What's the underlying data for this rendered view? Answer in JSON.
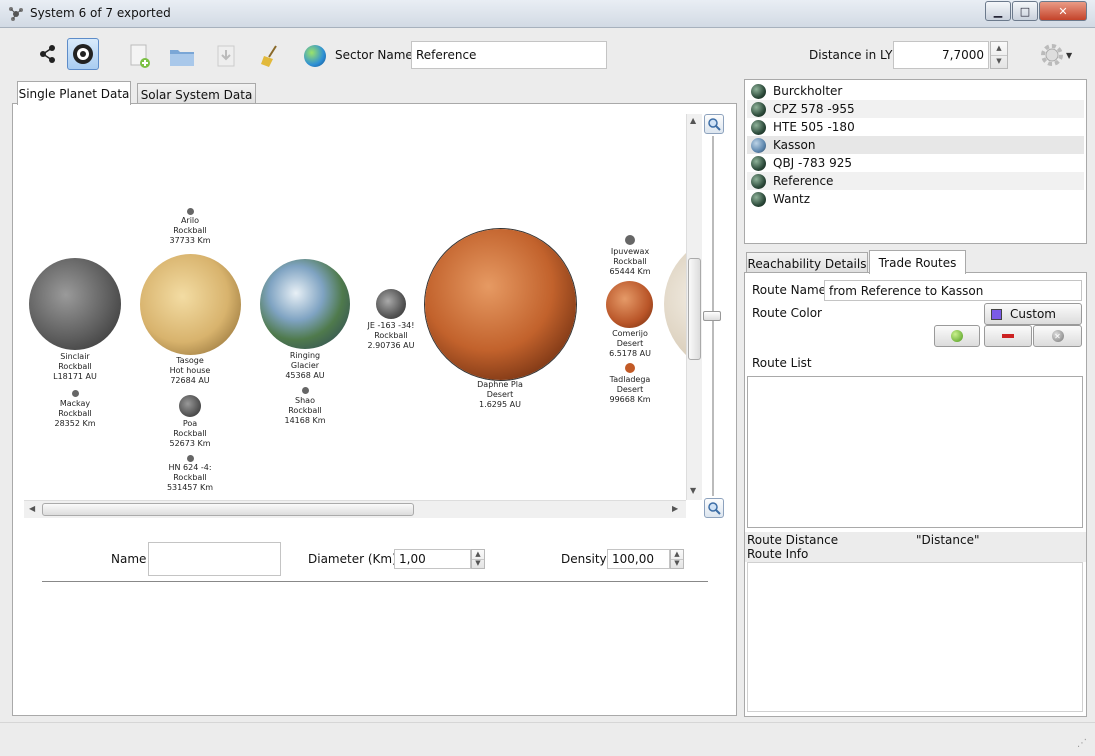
{
  "window": {
    "title": "System 6 of 7 exported",
    "minimize_label": "▁",
    "maximize_label": "□",
    "close_label": "✕"
  },
  "toolbar": {
    "sector_name_label": "Sector Name",
    "sector_name_value": "Reference",
    "distance_label": "Distance in LY",
    "distance_value": "7,7000"
  },
  "left_tabs": [
    {
      "label": "Single Planet Data"
    },
    {
      "label": "Solar System Data"
    }
  ],
  "planets": [
    {
      "name": "Sinclair",
      "type": "Rockball",
      "info": "L18171 AU"
    },
    {
      "name": "Mackay",
      "type": "Rockball",
      "info": "28352 Km"
    },
    {
      "name": "Arilo",
      "type": "Rockball",
      "info": "37733 Km"
    },
    {
      "name": "Tasoge",
      "type": "Hot house",
      "info": "72684 AU"
    },
    {
      "name": "Poa",
      "type": "Rockball",
      "info": "52673 Km"
    },
    {
      "name": "HN 624 -4:",
      "type": "Rockball",
      "info": "531457 Km"
    },
    {
      "name": "Ringing",
      "type": "Glacier",
      "info": "45368 AU"
    },
    {
      "name": "Shao",
      "type": "Rockball",
      "info": "14168 Km"
    },
    {
      "name": "JE -163 -34!",
      "type": "Rockball",
      "info": "2.90736 AU"
    },
    {
      "name": "Daphne Pla",
      "type": "Desert",
      "info": "1.6295 AU"
    },
    {
      "name": "Ipuvewax",
      "type": "Rockball",
      "info": "65444 Km"
    },
    {
      "name": "Comerijo",
      "type": "Desert",
      "info": "6.5178 AU"
    },
    {
      "name": "Tadladega",
      "type": "Desert",
      "info": "99668 Km"
    }
  ],
  "planet_form": {
    "name_label": "Name",
    "name_value": "",
    "diameter_label": "Diameter (Km)",
    "diameter_value": "1,00",
    "density_label": "Density",
    "density_value": "100,00"
  },
  "systems": [
    {
      "label": "Burckholter"
    },
    {
      "label": "CPZ 578 -955"
    },
    {
      "label": "HTE 505 -180"
    },
    {
      "label": "Kasson"
    },
    {
      "label": "QBJ -783 925"
    },
    {
      "label": "Reference"
    },
    {
      "label": "Wantz"
    }
  ],
  "right_tabs": [
    {
      "label": "Reachability Details"
    },
    {
      "label": "Trade Routes"
    }
  ],
  "trade_routes": {
    "route_name_label": "Route Name",
    "route_name_value": "from Reference to Kasson",
    "route_color_label": "Route Color",
    "color_button_label": "Custom",
    "route_color": "#7b5be8",
    "route_list_label": "Route List",
    "route_distance_label": "Route Distance",
    "route_distance_value": "\"Distance\"",
    "route_info_label": "Route Info"
  }
}
